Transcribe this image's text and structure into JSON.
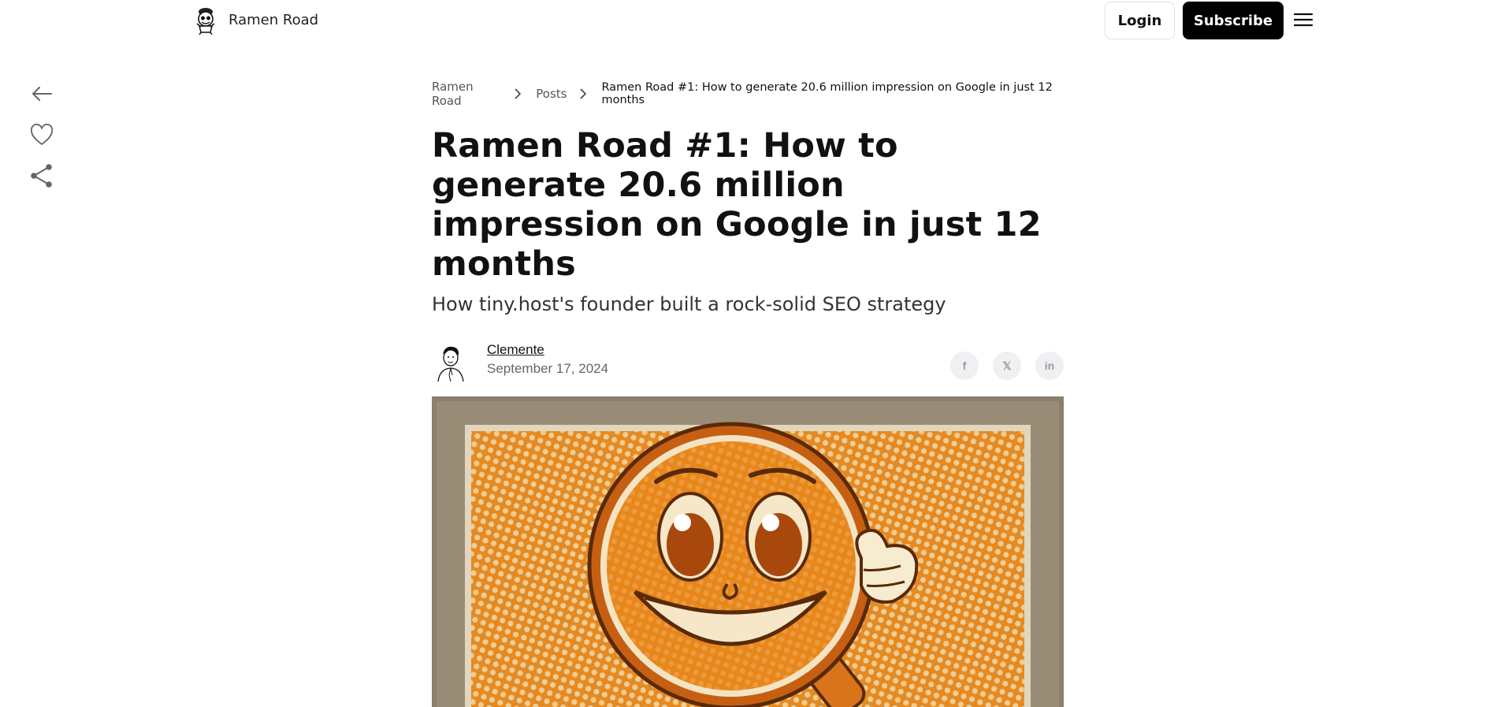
{
  "header": {
    "brand_name": "Ramen Road",
    "login_label": "Login",
    "subscribe_label": "Subscribe"
  },
  "breadcrumb": {
    "items": [
      "Ramen Road",
      "Posts"
    ],
    "current": "Ramen Road #1: How to generate 20.6 million impression on Google in just 12 months"
  },
  "article": {
    "title": "Ramen Road #1: How to generate 20.6 million impression on Google in just 12 months",
    "subtitle": "How tiny.host's founder built a rock-solid SEO strategy",
    "author": "Clemente",
    "date": "September 17, 2024"
  },
  "share": {
    "facebook": "f",
    "x": "𝕏",
    "linkedin": "in"
  },
  "icons": {
    "back": "arrow-left-icon",
    "like": "heart-icon",
    "share": "share-icon",
    "menu": "hamburger-icon"
  },
  "colors": {
    "accent": "#000000",
    "hero_orange": "#e8861a",
    "hero_background": "#8b7f6e"
  }
}
